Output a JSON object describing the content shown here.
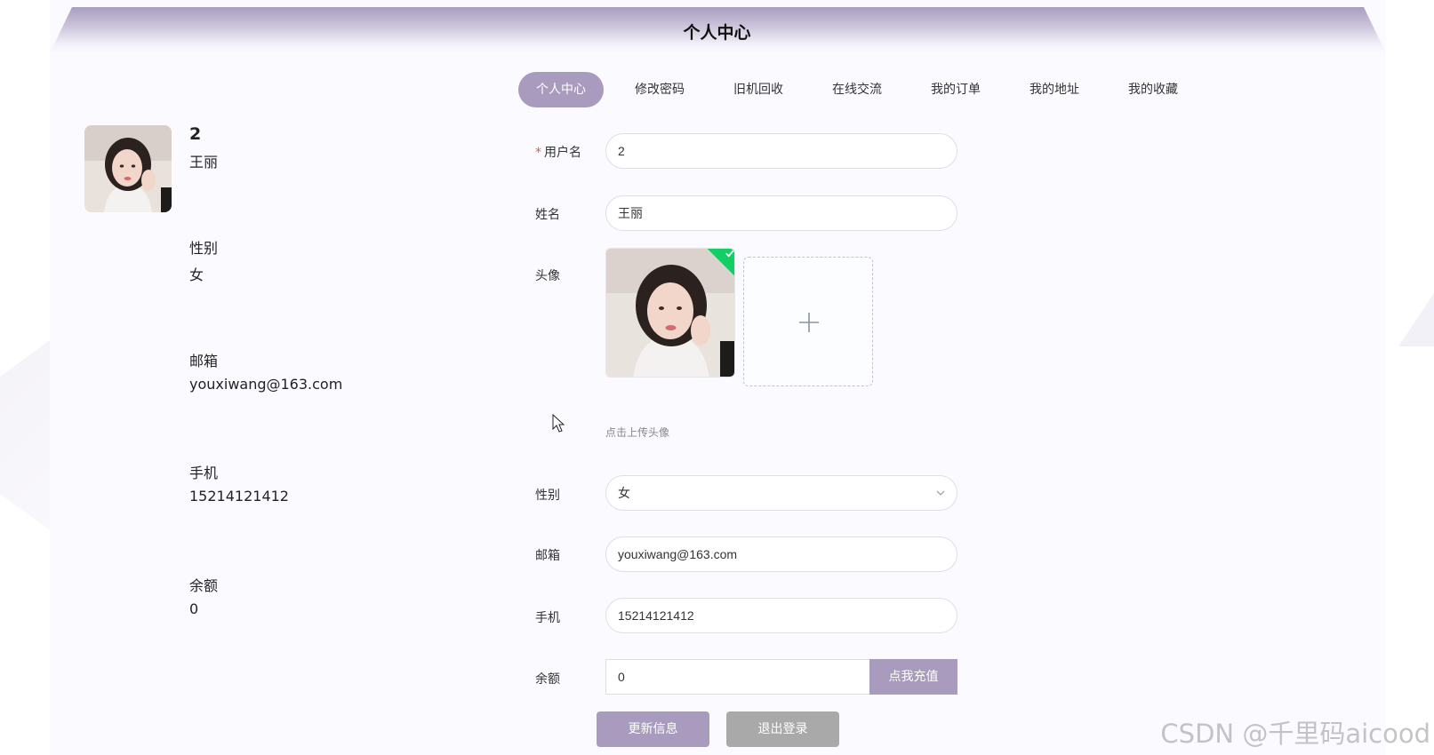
{
  "header": {
    "title": "个人中心"
  },
  "tabs": [
    {
      "label": "个人中心"
    },
    {
      "label": "修改密码"
    },
    {
      "label": "旧机回收"
    },
    {
      "label": "在线交流"
    },
    {
      "label": "我的订单"
    },
    {
      "label": "我的地址"
    },
    {
      "label": "我的收藏"
    }
  ],
  "summary": {
    "username": "2",
    "name": "王丽",
    "gender_label": "性别",
    "gender_value": "女",
    "email_label": "邮箱",
    "email_value": "youxiwang@163.com",
    "phone_label": "手机",
    "phone_value": "15214121412",
    "balance_label": "余额",
    "balance_value": "0"
  },
  "form": {
    "username_label": "用户名",
    "username_value": "2",
    "name_label": "姓名",
    "name_value": "王丽",
    "avatar_label": "头像",
    "avatar_tip": "点击上传头像",
    "gender_label": "性别",
    "gender_value": "女",
    "email_label": "邮箱",
    "email_value": "youxiwang@163.com",
    "phone_label": "手机",
    "phone_value": "15214121412",
    "balance_label": "余额",
    "balance_value": "0",
    "recharge_label": "点我充值"
  },
  "actions": {
    "update_label": "更新信息",
    "logout_label": "退出登录"
  },
  "watermark": "CSDN @千里码aicood",
  "colors": {
    "accent": "#a89bbd",
    "logout": "#a9a9a9",
    "success": "#13ce66",
    "required": "#e0584f"
  }
}
